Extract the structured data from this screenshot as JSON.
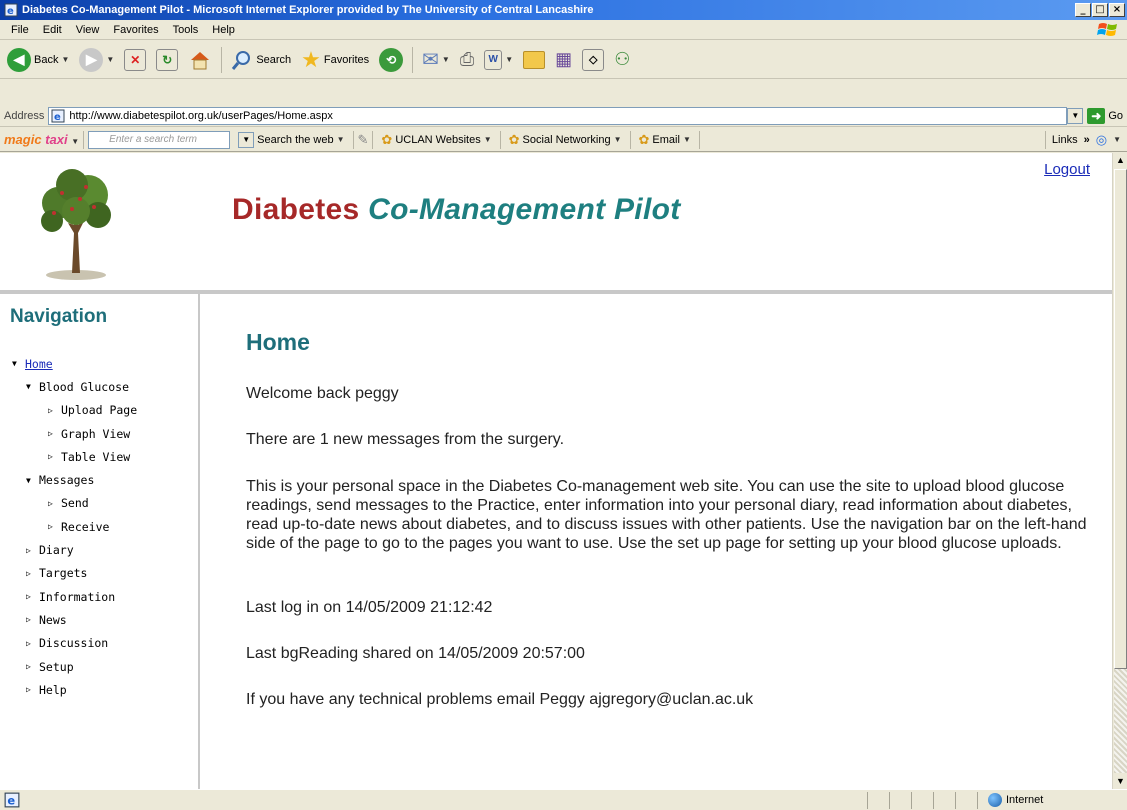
{
  "window": {
    "title": "Diabetes Co-Management Pilot - Microsoft Internet Explorer provided by The University of Central Lancashire",
    "buttons": [
      "_",
      "□",
      "×"
    ]
  },
  "menubar": {
    "items": [
      "File",
      "Edit",
      "View",
      "Favorites",
      "Tools",
      "Help"
    ]
  },
  "toolbar": {
    "back_label": "Back",
    "search_label": "Search",
    "favorites_label": "Favorites"
  },
  "address": {
    "label": "Address",
    "url": "http://www.diabetespilot.org.uk/userPages/Home.aspx",
    "go_label": "Go"
  },
  "linksbar": {
    "brand_prefix": "magic",
    "brand_suffix": "taxi",
    "search_placeholder": "Enter a search term",
    "search_web_label": "Search the web",
    "uclan_label": "UCLAN Websites",
    "social_label": "Social Networking",
    "email_label": "Email",
    "links_label": "Links"
  },
  "page": {
    "logout_label": "Logout",
    "site_title_word1": "Diabetes",
    "site_title_word2": "Co-Management Pilot",
    "nav_heading": "Navigation",
    "nav": [
      {
        "label": "Home",
        "level": 0,
        "expanded": true
      },
      {
        "label": "Blood Glucose",
        "level": 1,
        "expanded": true
      },
      {
        "label": "Upload Page",
        "level": 2
      },
      {
        "label": "Graph View",
        "level": 2
      },
      {
        "label": "Table View",
        "level": 2
      },
      {
        "label": "Messages",
        "level": 1,
        "expanded": true
      },
      {
        "label": "Send",
        "level": 2
      },
      {
        "label": "Receive",
        "level": 2
      },
      {
        "label": "Diary",
        "level": 1
      },
      {
        "label": "Targets",
        "level": 1
      },
      {
        "label": "Information",
        "level": 1
      },
      {
        "label": "News",
        "level": 1
      },
      {
        "label": "Discussion",
        "level": 1
      },
      {
        "label": "Setup",
        "level": 1
      },
      {
        "label": "Help",
        "level": 1
      }
    ],
    "heading": "Home",
    "welcome": "Welcome back peggy",
    "messages_notice": "There are 1 new messages from the surgery.",
    "intro": "This is your personal space in the Diabetes Co-management web site. You can use the site to upload blood glucose readings, send messages to the Practice, enter information into your personal diary, read information about diabetes, read up-to-date news about diabetes, and to discuss issues with other patients. Use the navigation bar on the left-hand side of the page to go to the pages you want to use. Use the set up page for setting up your blood glucose uploads.",
    "last_login": "Last log in on 14/05/2009 21:12:42",
    "last_reading": "Last bgReading shared on 14/05/2009 20:57:00",
    "support": "If you have any technical problems email Peggy ajgregory@uclan.ac.uk"
  },
  "statusbar": {
    "zone_label": "Internet"
  }
}
